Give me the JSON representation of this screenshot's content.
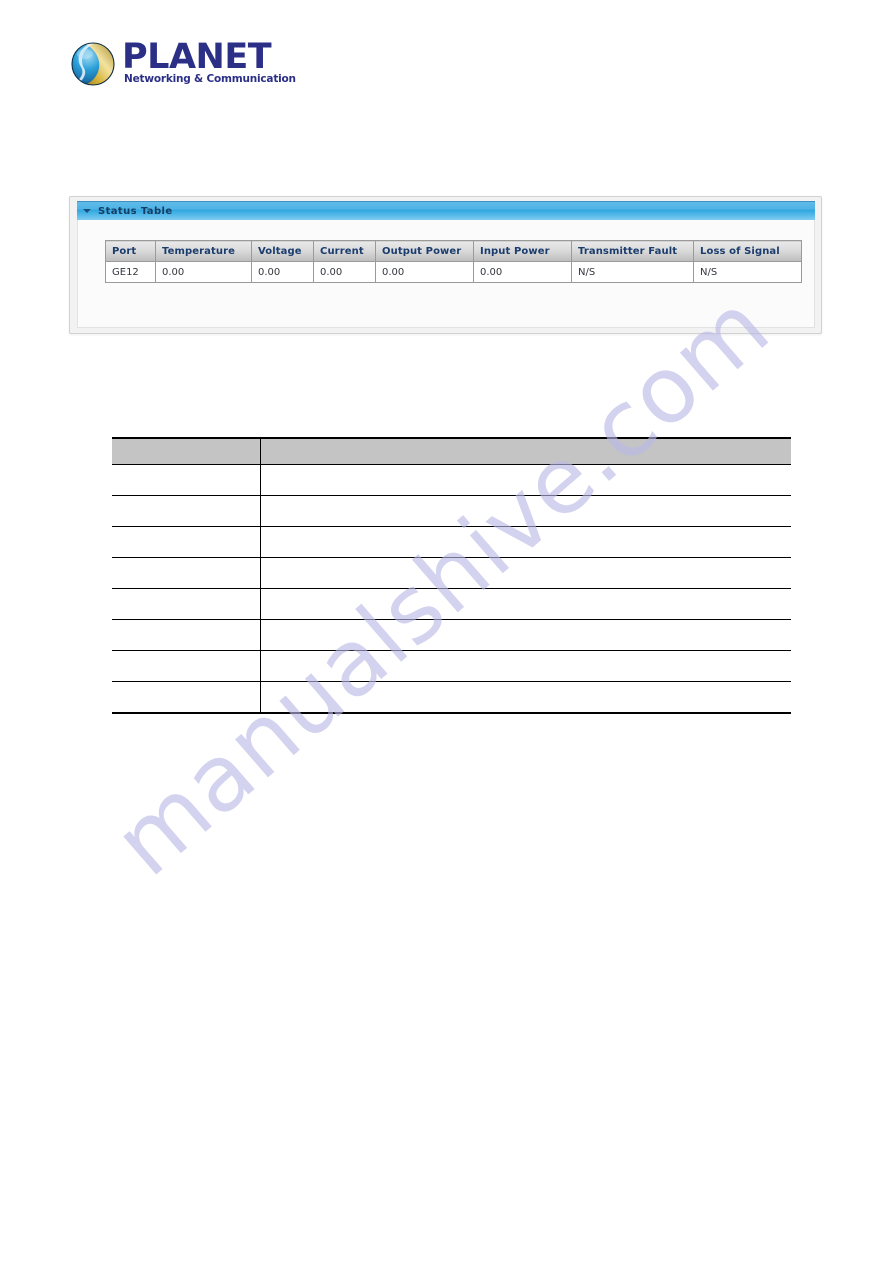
{
  "brand": {
    "name": "PLANET",
    "tagline": "Networking & Communication",
    "logo_icon": "globe-icon",
    "wordmark_color": "#2b2f86",
    "globe_colors": {
      "blue": "#2a9fd8",
      "gold": "#c9a227",
      "dark": "#1b3a6b"
    }
  },
  "watermark": {
    "text": "manualshive.com",
    "color": "#b9b9e8"
  },
  "status_panel": {
    "title": "Status Table",
    "collapse_icon": "chevron-down-icon",
    "header_color": "#31a7e0",
    "title_color": "#143d63"
  },
  "status_table": {
    "columns": [
      "Port",
      "Temperature",
      "Voltage",
      "Current",
      "Output Power",
      "Input Power",
      "Transmitter Fault",
      "Loss of Signal"
    ],
    "rows": [
      {
        "port": "GE12",
        "temperature": "0.00",
        "voltage": "0.00",
        "current": "0.00",
        "output_power": "0.00",
        "input_power": "0.00",
        "transmitter_fault": "N/S",
        "loss_of_signal": "N/S"
      }
    ]
  },
  "description_table": {
    "header_bg": "#c4c4c4",
    "columns": [
      "",
      ""
    ],
    "rows": [
      [
        "",
        ""
      ],
      [
        "",
        ""
      ],
      [
        "",
        ""
      ],
      [
        "",
        ""
      ],
      [
        "",
        ""
      ],
      [
        "",
        ""
      ],
      [
        "",
        ""
      ],
      [
        "",
        ""
      ]
    ]
  }
}
